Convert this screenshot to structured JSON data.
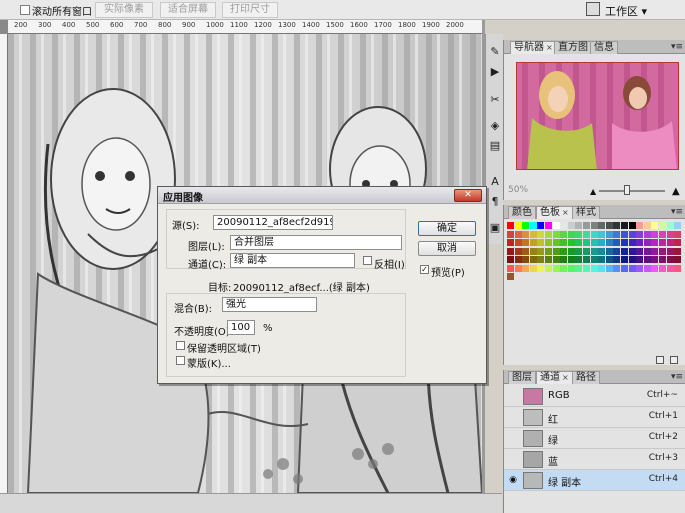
{
  "options_bar": {
    "scroll_all_label": "滚动所有窗口",
    "actual_pixels": "实际像素",
    "fit_screen": "适合屏幕",
    "print_size": "打印尺寸",
    "workspace": "工作区 ▾"
  },
  "ruler": {
    "marks": [
      "200",
      "300",
      "400",
      "500",
      "600",
      "700",
      "800",
      "900",
      "1000",
      "1100",
      "1200",
      "1300",
      "1400",
      "1500",
      "1600",
      "1700",
      "1800",
      "1900",
      "2000"
    ]
  },
  "navigator": {
    "tabs": [
      "导航器",
      "直方图",
      "信息"
    ],
    "zoom": "50%"
  },
  "swatches_panel": {
    "tabs": [
      "颜色",
      "色板",
      "样式"
    ]
  },
  "channels_panel": {
    "tabs": [
      "图层",
      "通道",
      "路径"
    ],
    "rows": [
      {
        "name": "RGB",
        "key": "Ctrl+~",
        "visible": false,
        "selected": false
      },
      {
        "name": "红",
        "key": "Ctrl+1",
        "visible": false,
        "selected": false
      },
      {
        "name": "绿",
        "key": "Ctrl+2",
        "visible": false,
        "selected": false
      },
      {
        "name": "蓝",
        "key": "Ctrl+3",
        "visible": false,
        "selected": false
      },
      {
        "name": "绿 副本",
        "key": "Ctrl+4",
        "visible": true,
        "selected": true
      }
    ]
  },
  "dialog": {
    "title": "应用图像",
    "source_label": "源(S):",
    "source_value": "20090112_af8ecf2d919....",
    "layer_label": "图层(L):",
    "layer_value": "合并图层",
    "channel_label": "通道(C):",
    "channel_value": "绿 副本",
    "invert_label": "反相(I)",
    "target_label": "目标:",
    "target_value": "20090112_af8ecf...(绿 副本)",
    "blend_label": "混合(B):",
    "blend_value": "强光",
    "opacity_label": "不透明度(O):",
    "opacity_value": "100",
    "opacity_unit": "%",
    "preserve_label": "保留透明区域(T)",
    "mask_label": "蒙版(K)...",
    "ok": "确定",
    "cancel": "取消",
    "preview_label": "预览(P)"
  }
}
